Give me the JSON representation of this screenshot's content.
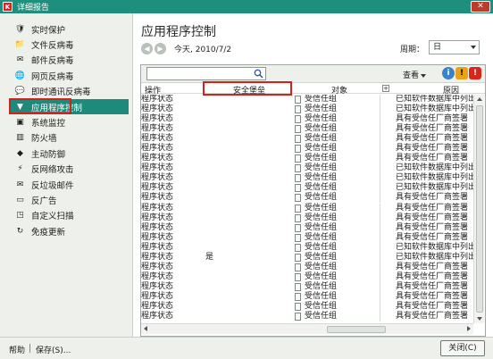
{
  "window": {
    "title": "详细报告",
    "close_label": "✕"
  },
  "sidebar": {
    "items": [
      {
        "label": "实时保护",
        "icon": "shield-icon"
      },
      {
        "label": "文件反病毒",
        "icon": "folder-icon"
      },
      {
        "label": "邮件反病毒",
        "icon": "mail-icon"
      },
      {
        "label": "网页反病毒",
        "icon": "globe-icon"
      },
      {
        "label": "即时通讯反病毒",
        "icon": "chat-icon"
      },
      {
        "label": "应用程序控制",
        "icon": "filter-icon",
        "active": true
      },
      {
        "label": "系统监控",
        "icon": "monitor-icon"
      },
      {
        "label": "防火墙",
        "icon": "firewall-icon"
      },
      {
        "label": "主动防御",
        "icon": "defense-icon"
      },
      {
        "label": "反网络攻击",
        "icon": "network-attack-icon"
      },
      {
        "label": "反垃圾邮件",
        "icon": "antispam-icon"
      },
      {
        "label": "反广告",
        "icon": "antibanner-icon"
      },
      {
        "label": "自定义扫描",
        "icon": "scan-icon"
      },
      {
        "label": "免疫更新",
        "icon": "update-icon"
      }
    ]
  },
  "main": {
    "title": "应用程序控制",
    "date_label": "今天, 2010/7/2",
    "period_label": "周期：",
    "period_value": "日",
    "toolbar": {
      "view_label": "查看"
    },
    "columns": {
      "action": "操作",
      "security_group": "安全堡垒",
      "object": "对象",
      "reason": "原因"
    },
    "rows": [
      {
        "action": "程序状态",
        "group": "",
        "object": "受信任组",
        "reason": "已知软件数据库中列出"
      },
      {
        "action": "程序状态",
        "group": "",
        "object": "受信任组",
        "reason": "已知软件数据库中列出"
      },
      {
        "action": "程序状态",
        "group": "",
        "object": "受信任组",
        "reason": "具有受信任厂商签署"
      },
      {
        "action": "程序状态",
        "group": "",
        "object": "受信任组",
        "reason": "具有受信任厂商签署"
      },
      {
        "action": "程序状态",
        "group": "",
        "object": "受信任组",
        "reason": "具有受信任厂商签署"
      },
      {
        "action": "程序状态",
        "group": "",
        "object": "受信任组",
        "reason": "具有受信任厂商签署"
      },
      {
        "action": "程序状态",
        "group": "",
        "object": "受信任组",
        "reason": "具有受信任厂商签署"
      },
      {
        "action": "程序状态",
        "group": "",
        "object": "受信任组",
        "reason": "已知软件数据库中列出"
      },
      {
        "action": "程序状态",
        "group": "",
        "object": "受信任组",
        "reason": "已知软件数据库中列出"
      },
      {
        "action": "程序状态",
        "group": "",
        "object": "受信任组",
        "reason": "已知软件数据库中列出"
      },
      {
        "action": "程序状态",
        "group": "",
        "object": "受信任组",
        "reason": "具有受信任厂商签署"
      },
      {
        "action": "程序状态",
        "group": "",
        "object": "受信任组",
        "reason": "具有受信任厂商签署"
      },
      {
        "action": "程序状态",
        "group": "",
        "object": "受信任组",
        "reason": "具有受信任厂商签署"
      },
      {
        "action": "程序状态",
        "group": "",
        "object": "受信任组",
        "reason": "具有受信任厂商签署"
      },
      {
        "action": "程序状态",
        "group": "",
        "object": "受信任组",
        "reason": "具有受信任厂商签署"
      },
      {
        "action": "程序状态",
        "group": "",
        "object": "受信任组",
        "reason": "已知软件数据库中列出"
      },
      {
        "action": "程序状态",
        "group": "是",
        "object": "受信任组",
        "reason": "已知软件数据库中列出"
      },
      {
        "action": "程序状态",
        "group": "",
        "object": "受信任组",
        "reason": "具有受信任厂商签署"
      },
      {
        "action": "程序状态",
        "group": "",
        "object": "受信任组",
        "reason": "具有受信任厂商签署"
      },
      {
        "action": "程序状态",
        "group": "",
        "object": "受信任组",
        "reason": "具有受信任厂商签署"
      },
      {
        "action": "程序状态",
        "group": "",
        "object": "受信任组",
        "reason": "具有受信任厂商签署"
      },
      {
        "action": "程序状态",
        "group": "",
        "object": "受信任组",
        "reason": "具有受信任厂商签署"
      },
      {
        "action": "程序状态",
        "group": "",
        "object": "受信任组",
        "reason": "具有受信任厂商签署"
      }
    ]
  },
  "bottom": {
    "help_label": "帮助",
    "save_label": "保存(S)...",
    "close_label": "关闭(C)"
  },
  "colors": {
    "accent": "#1e8a7b",
    "highlight": "#d8201a"
  }
}
